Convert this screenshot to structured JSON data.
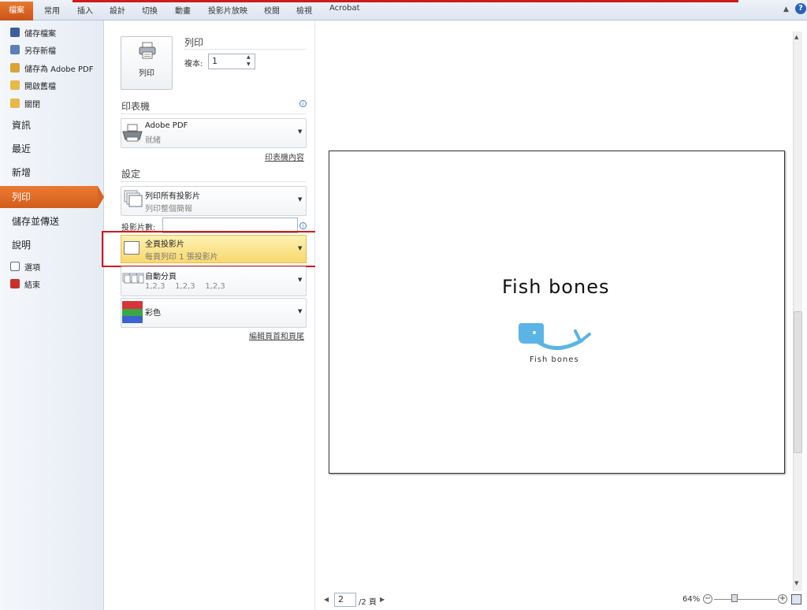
{
  "ribbon": {
    "file_tab": "檔案",
    "tabs": [
      "常用",
      "插入",
      "設計",
      "切換",
      "動畫",
      "投影片放映",
      "校閱",
      "檢視",
      "Acrobat"
    ],
    "help_label": "?"
  },
  "nav": {
    "small_items": [
      "儲存檔案",
      "另存新檔",
      "儲存為 Adobe PDF",
      "開啟舊檔",
      "關閉"
    ],
    "large_items": [
      "資訊",
      "最近",
      "新增",
      "列印",
      "儲存並傳送",
      "說明"
    ],
    "bottom_items": [
      "選項",
      "結束"
    ]
  },
  "print": {
    "button_label": "列印",
    "title": "列印",
    "copies_label": "複本:",
    "copies_value": "1"
  },
  "printer": {
    "heading": "印表機",
    "name": "Adobe PDF",
    "status": "就緒",
    "properties_link": "印表機內容"
  },
  "settings": {
    "heading": "設定",
    "range_title": "列印所有投影片",
    "range_sub": "列印整個簡報",
    "slides_label": "投影片數:",
    "layout_title": "全頁投影片",
    "layout_sub": "每頁列印 1 張投影片",
    "collate_title": "自動分頁",
    "collate_sub": "1,2,3    1,2,3    1,2,3",
    "color_title": "彩色",
    "header_footer_link": "編輯頁首和頁尾"
  },
  "preview": {
    "slide_title": "Fish  bones",
    "logo_text": "Fish bones",
    "current_page": "2",
    "total_pages": "/2 頁",
    "zoom": "64%"
  },
  "colors": {
    "file_tab": "#d9622a",
    "nav_active": "#e06b28",
    "highlight": "#fbe18a",
    "red_annotation": "#d11a1a",
    "logo_blue": "#5ab4e6"
  }
}
